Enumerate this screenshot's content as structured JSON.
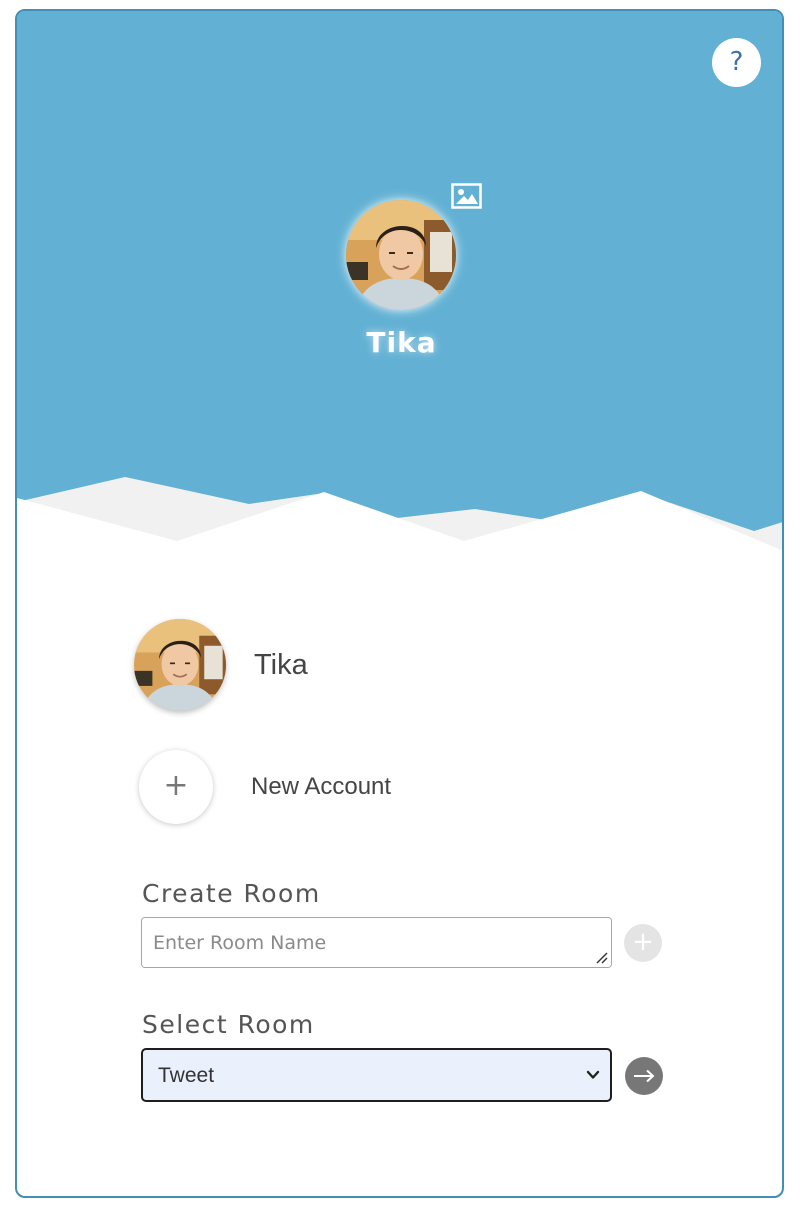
{
  "help": {
    "label": "?"
  },
  "profile": {
    "name": "Tika"
  },
  "accounts": [
    {
      "name": "Tika"
    }
  ],
  "new_account": {
    "plus": "+",
    "label": "New Account"
  },
  "create_room": {
    "label": "Create Room",
    "placeholder": "Enter Room Name",
    "add_symbol": "+"
  },
  "select_room": {
    "label": "Select Room",
    "selected": "Tweet"
  },
  "colors": {
    "sky": "#62b1d4",
    "card_border": "#3f8fb6",
    "mountain_back": "#f1f1f1",
    "select_bg": "#eaf1fd",
    "go_button": "#777777"
  },
  "icons": {
    "help": "question-mark-icon",
    "change_photo": "image-icon",
    "add": "plus-icon",
    "go": "arrow-right-icon",
    "dropdown": "chevron-down-icon"
  }
}
